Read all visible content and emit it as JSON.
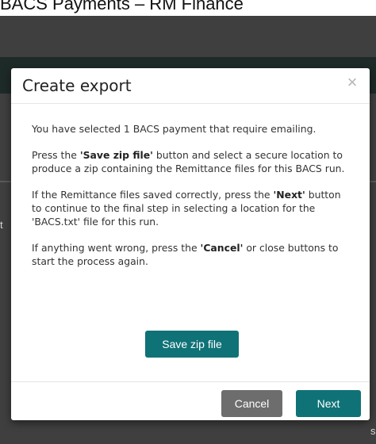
{
  "page": {
    "title": "BACS Payments – RM Finance"
  },
  "background": {
    "edge_char_left": "t",
    "edge_char_right": "s"
  },
  "modal": {
    "title": "Create export",
    "close_icon": "close-icon",
    "paragraphs": {
      "p1": "You have selected 1 BACS payment that require emailing.",
      "p2_pre": "Press the ",
      "p2_bold": "'Save zip file'",
      "p2_post": " button and select a secure location to produce a zip containing the Remittance files for this BACS run.",
      "p3_pre": "If the Remittance files saved correctly, press the ",
      "p3_bold": "'Next'",
      "p3_post": " button to continue to the final step in selecting a location for the 'BACS.txt' file for this run.",
      "p4_pre": "If anything went wrong, press the ",
      "p4_bold": "'Cancel'",
      "p4_post": " or close buttons to start the process again."
    },
    "save_zip_label": "Save zip file",
    "cancel_label": "Cancel",
    "next_label": "Next"
  },
  "colors": {
    "accent": "#0f7277",
    "cancel": "#6d6d6d",
    "backdrop": "#3f3f3f"
  }
}
